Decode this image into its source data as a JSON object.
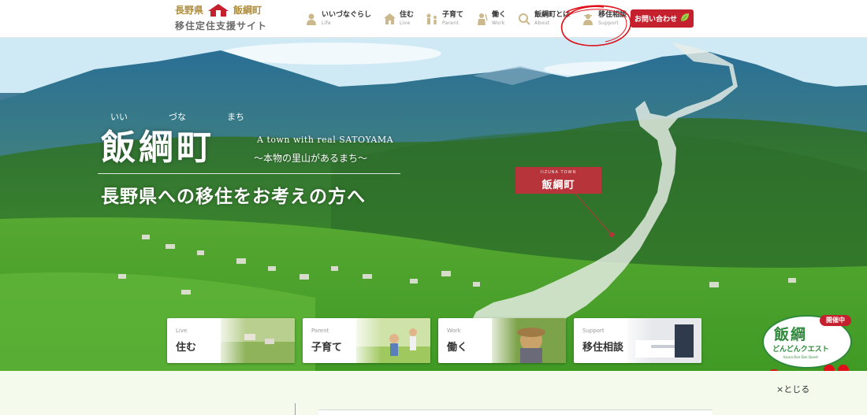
{
  "header": {
    "logo": {
      "prefecture": "長野県",
      "town": "飯綱町",
      "site_name": "移住定住支援サイト"
    },
    "nav": [
      {
        "jp": "いいづなぐらし",
        "en": "Life",
        "icon": "person-icon"
      },
      {
        "jp": "住む",
        "en": "Live",
        "icon": "house-icon"
      },
      {
        "jp": "子育て",
        "en": "Parent",
        "icon": "family-icon"
      },
      {
        "jp": "働く",
        "en": "Work",
        "icon": "worker-icon"
      },
      {
        "jp": "飯綱町とは",
        "en": "About",
        "icon": "magnifier-icon"
      },
      {
        "jp": "移住相談",
        "en": "Support",
        "icon": "consultant-icon"
      }
    ],
    "contact": {
      "label": "お問い合わせ",
      "icon": "leaf-icon"
    }
  },
  "hero": {
    "ruby": [
      "いい",
      "づな",
      "まち"
    ],
    "title": "飯綱町",
    "tagline_en": "A town with real SATOYAMA",
    "tagline_jp": "～本物の里山があるまち～",
    "subtitle": "長野県への移住をお考えの方へ",
    "map_tag": {
      "en": "IIZUNA TOWN",
      "jp": "飯綱町"
    }
  },
  "cards": [
    {
      "en": "Live",
      "jp": "住む"
    },
    {
      "en": "Parent",
      "jp": "子育て"
    },
    {
      "en": "Work",
      "jp": "働く"
    },
    {
      "en": "Support",
      "jp": "移住相談"
    }
  ],
  "quest": {
    "badge": "開催中",
    "title": "飯綱",
    "subtitle": "どんどんクエスト",
    "en": "Iizuna Don Don Quest"
  },
  "banner": {
    "close_label": "×とじる"
  },
  "colors": {
    "accent_red": "#c5202e",
    "town_tag": "#b7343a",
    "annotation": "#e0101a",
    "banner_bg": "#f5fbec"
  }
}
